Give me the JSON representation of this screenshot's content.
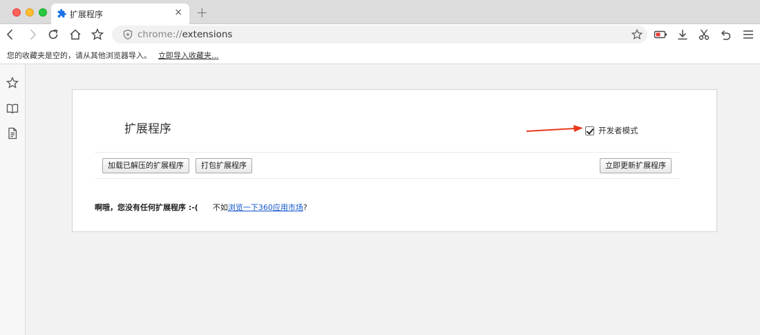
{
  "tab": {
    "title": "扩展程序",
    "close": "×",
    "new_tab": "+"
  },
  "omnibox": {
    "scheme": "chrome://",
    "path": "extensions"
  },
  "bookmarks": {
    "message": "您的收藏夹是空的，请从其他浏览器导入。",
    "import_link": "立即导入收藏夹..."
  },
  "page": {
    "title": "扩展程序",
    "dev_mode_label": "开发者模式",
    "dev_mode_checked": true,
    "buttons": {
      "load_unpacked": "加载已解压的扩展程序",
      "pack": "打包扩展程序",
      "update": "立即更新扩展程序"
    },
    "empty": {
      "bold": "啊哦，您没有任何扩展程序 :-(",
      "prefix": "不如",
      "link": "浏览一下360应用市场",
      "suffix": "?"
    }
  },
  "colors": {
    "link": "#1155cc",
    "arrow": "#e8391d",
    "tab_icon": "#1a73e8"
  }
}
